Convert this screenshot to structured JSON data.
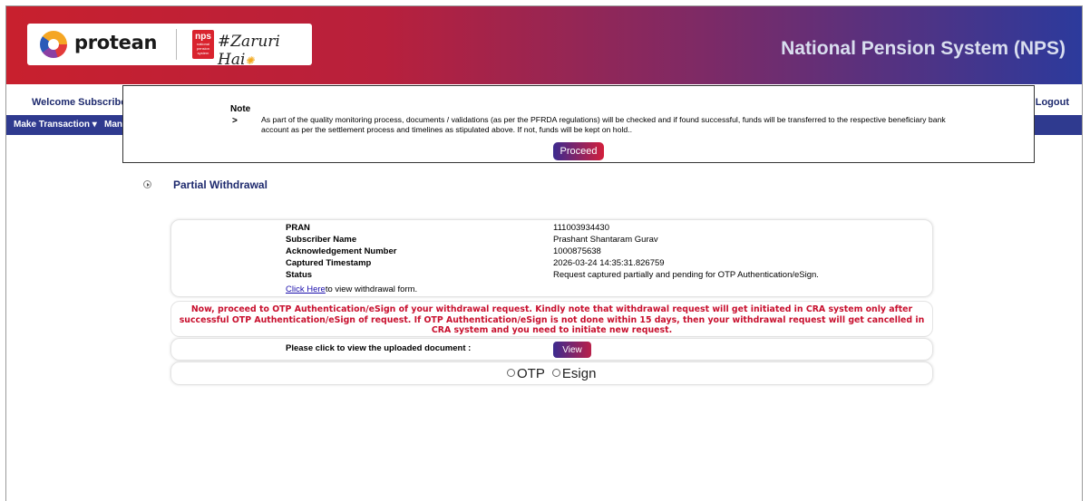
{
  "header": {
    "brand_name": "protean",
    "nps_badge_big": "nps",
    "nps_badge_small": "national pension system",
    "tagline": "#Zaruri Hai",
    "site_title": "National Pension System (NPS)"
  },
  "topbar": {
    "welcome": "Welcome Subscriber-",
    "logout": "| Logout"
  },
  "nav": {
    "items": [
      "Make Transaction",
      "Mana"
    ]
  },
  "modal": {
    "note_title": "Note",
    "arrow": ">",
    "note_text": "As part of the quality monitoring process, documents / validations (as per the PFRDA regulations) will be checked and if found successful, funds will be transferred to the respective beneficiary bank account as per the settlement process and timelines as stipulated above. If not, funds will be kept on hold..",
    "proceed_label": "Proceed"
  },
  "page": {
    "section_title": "Partial Withdrawal"
  },
  "details": [
    {
      "label": "PRAN",
      "value": "111003934430"
    },
    {
      "label": "Subscriber Name",
      "value": "Prashant Shantaram Gurav"
    },
    {
      "label": "Acknowledgement Number",
      "value": "1000875638"
    },
    {
      "label": "Captured Timestamp",
      "value": "2026-03-24 14:35:31.826759"
    },
    {
      "label": "Status",
      "value": "Request captured partially and pending for OTP Authentication/eSign."
    }
  ],
  "link": {
    "text": "Click Here",
    "suffix": "to view withdrawal form."
  },
  "warning": {
    "text": "Now, proceed to OTP Authentication/eSign of your withdrawal request. Kindly note that withdrawal request will get initiated in CRA system only after successful OTP Authentication/eSign of request. If OTP Authentication/eSign is not done within 15 days, then your withdrawal request will get cancelled in CRA system and you need to initiate new request."
  },
  "document": {
    "label": "Please click to view the uploaded document :",
    "view_label": "View"
  },
  "auth": {
    "otp_label": "OTP",
    "esign_label": "Esign"
  },
  "colors": {
    "nav_bg": "#2f3a8f",
    "warning_text": "#c8102e",
    "title_text": "#1e2a6e"
  }
}
